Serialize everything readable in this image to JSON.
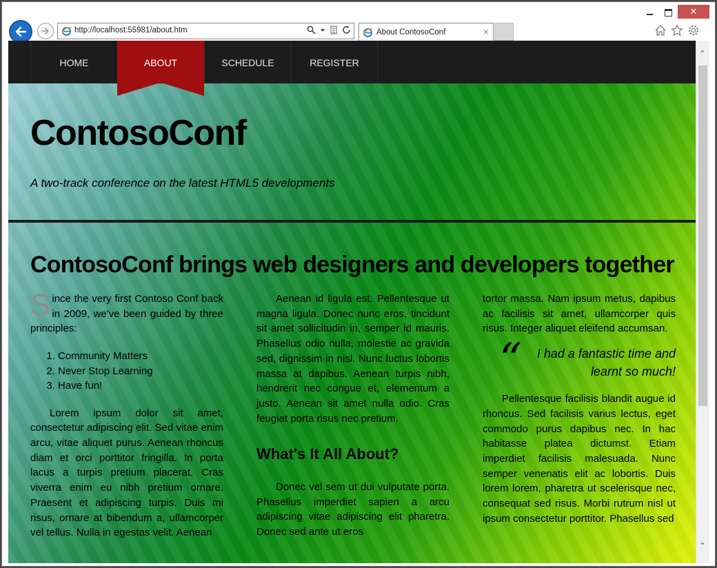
{
  "browser": {
    "url": "http://localhost:55981/about.htm",
    "tab_title": "About ContosoConf",
    "tab_close": "×",
    "window_close": "✕"
  },
  "nav": {
    "items": [
      {
        "label": "HOME"
      },
      {
        "label": "ABOUT"
      },
      {
        "label": "SCHEDULE"
      },
      {
        "label": "REGISTER"
      }
    ],
    "active": "ABOUT"
  },
  "header": {
    "title": "ContosoConf",
    "tagline": "A two-track conference on the latest HTML5 developments"
  },
  "main": {
    "headline": "ContosoConf brings web designers and developers together",
    "col1": {
      "dropcap": "S",
      "intro": "ince the very first Contoso Conf back in 2009, we've been guided by three principles:",
      "principles": [
        "Community Matters",
        "Never Stop Learning",
        "Have fun!"
      ],
      "para": "Lorem ipsum dolor sit amet, consectetur adipiscing elit. Sed vitae enim arcu, vitae aliquet purus. Aenean rhoncus diam et orci porttitor fringilla. In porta lacus a turpis pretium placerat. Cras viverra enim eu nibh pretium ornare. Praesent et adipiscing turpis. Duis mi risus, ornare at bibendum a, ullamcorper vel tellus. Nulla in egestas velit. Aenean"
    },
    "col2": {
      "para1": "Aenean id ligula est. Pellentesque ut magna ligula. Donec nunc eros, tincidunt sit amet sollicitudin in, semper id mauris. Phasellus odio nulla, molestie ac gravida sed, dignissim in nisl. Nunc luctus lobortis massa at dapibus. Aenean turpis nibh, hendrerit nec congue et, elementum a justo. Aenean sit amet nulla odio. Cras feugiat porta risus nec pretium.",
      "subheading": "What's It All About?",
      "para2": "Donec vel sem ut dui vulputate porta. Phasellus imperdiet sapien a arcu adipiscing vitae adipiscing elit pharetra. Donec sed ante ut eros"
    },
    "col3": {
      "para1": "tortor massa. Nam ipsum metus, dapibus ac facilisis sit amet, ullamcorper quis risus. Integer aliquet eleifend accumsan.",
      "quote_mark": "“",
      "quote": "I had a fantastic time and learnt so much!",
      "para2": "Pellentesque facilisis blandit augue id rhoncus. Sed facilisis varius lectus, eget commodo purus dapibus nec. In hac habitasse platea dictumst. Etiam imperdiet facilisis malesuada. Nunc semper venenatis elit ac lobortis. Duis lorem lorem, pharetra ut scelerisque nec, consequat sed risus. Morbi rutrum nisl ut ipsum consectetur porttitor. Phasellus sed"
    }
  },
  "colors": {
    "nav_bg": "#1c1c1c",
    "active_ribbon": "#a00f10",
    "close_button": "#c75050",
    "back_button": "#1e6fc9"
  }
}
